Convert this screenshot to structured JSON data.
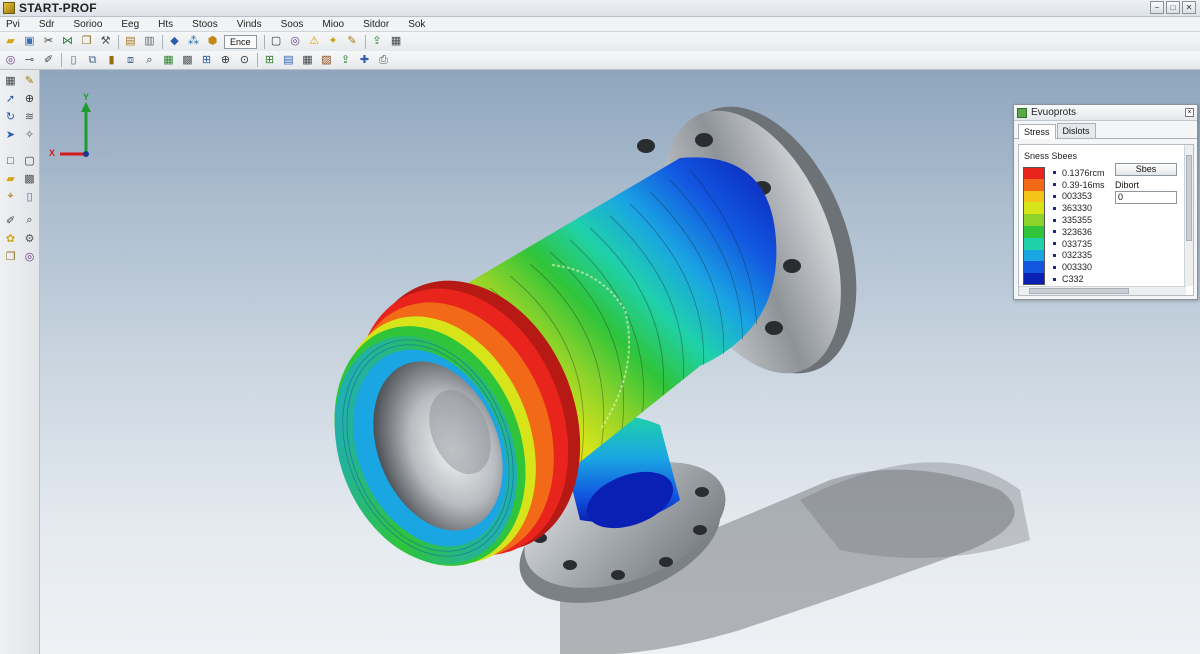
{
  "app": {
    "title": "START-PROF"
  },
  "window_controls": [
    "−",
    "□",
    "✕"
  ],
  "menu": [
    "Pvi",
    "Sdr",
    "Sorioo",
    "Eeg",
    "Hts",
    "Stoos",
    "Vinds",
    "Soos",
    "Mioo",
    "Sitdor",
    "Sok"
  ],
  "toolbar": {
    "text_button": "Ence",
    "row1_icons": [
      "folder-icon",
      "save-icon",
      "scissors-icon",
      "network-icon",
      "copy-icon",
      "hammer-icon",
      "sep",
      "clipboard-icon",
      "document-icon",
      "sep",
      "diamond-icon",
      "nodes-icon",
      "cube-icon",
      "text-button",
      "sep",
      "frame-icon",
      "target-icon",
      "warning-icon",
      "bolt-icon",
      "note-icon",
      "sep",
      "export-icon",
      "window-icon"
    ],
    "row2_icons": [
      "target-icon",
      "pipe-icon",
      "pen-icon",
      "sep",
      "page-icon",
      "page-copy-icon",
      "page-edit-icon",
      "pages-icon",
      "search-icon",
      "chart-icon",
      "box-icon",
      "grid-icon",
      "zoom-icon",
      "zoom-fit-icon",
      "sep",
      "grid-add-icon",
      "table-icon",
      "window-icon",
      "image-icon",
      "export-icon",
      "plugin-icon",
      "print-icon"
    ]
  },
  "left_toolbar_icons": [
    [
      "window-icon",
      "note-icon"
    ],
    [
      "cursor-icon",
      "zoom-icon"
    ],
    [
      "rotate-icon",
      "layers-icon"
    ],
    [
      "pointer-icon",
      "orbit-icon"
    ],
    [
      "square-icon",
      "frame-icon"
    ],
    [
      "folder-icon",
      "box-icon"
    ],
    [
      "tag-icon",
      "page-icon"
    ],
    [
      "pen-icon",
      "search-icon"
    ],
    [
      "paint-icon",
      "gear-icon"
    ],
    [
      "copy-icon",
      "target-icon"
    ]
  ],
  "axis_triad": {
    "x_label": "X",
    "y_label": "Y"
  },
  "colors": {
    "accent": "#2a5db0",
    "stress_max": "#e8241c",
    "stress_min": "#0a1fb4",
    "metal": "#9ea3a8"
  },
  "results_panel": {
    "title": "Evuoprots",
    "tabs": [
      {
        "label": "Stress",
        "active": true
      },
      {
        "label": "Dislots",
        "active": false
      }
    ],
    "legend_title": "Sness Sbees",
    "legend": [
      {
        "color": "#e8241c",
        "value": "0.1376rcm"
      },
      {
        "color": "#f26a18",
        "value": "0.39-16ms"
      },
      {
        "color": "#f5c419",
        "value": "003353"
      },
      {
        "color": "#d7e41a",
        "value": "363330"
      },
      {
        "color": "#8ed32a",
        "value": "335355"
      },
      {
        "color": "#2fc43a",
        "value": "323636"
      },
      {
        "color": "#1fd1a8",
        "value": "033735"
      },
      {
        "color": "#1aa6e2",
        "value": "032335"
      },
      {
        "color": "#1256e0",
        "value": "003330"
      },
      {
        "color": "#0a1fb4",
        "value": "C332"
      }
    ],
    "button": "Sbes",
    "field_label": "Dibort",
    "field_value": "0"
  }
}
